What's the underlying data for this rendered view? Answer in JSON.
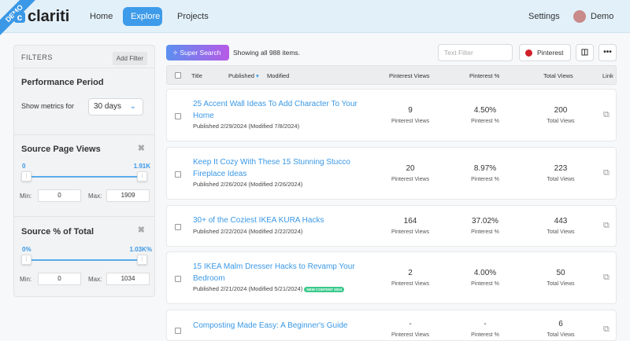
{
  "header": {
    "demo": "DEMO",
    "logo": "clariti",
    "nav": [
      "Home",
      "Explore",
      "Projects"
    ],
    "settings": "Settings",
    "user": "Demo"
  },
  "filters": {
    "title": "FILTERS",
    "add": "Add Filter",
    "period": {
      "title": "Performance Period",
      "label": "Show metrics for",
      "value": "30 days"
    },
    "spv": {
      "title": "Source Page Views",
      "lo": "0",
      "hi": "1.91K",
      "min_label": "Min:",
      "max_label": "Max:",
      "min": "0",
      "max": "1909"
    },
    "spt": {
      "title": "Source % of Total",
      "lo": "0%",
      "hi": "1.03K%",
      "min_label": "Min:",
      "max_label": "Max:",
      "min": "0",
      "max": "1034"
    }
  },
  "toolbar": {
    "super_search": "Super Search",
    "showing": "Showing all 988 items.",
    "text_filter": "Text Filter",
    "source": "Pinterest"
  },
  "columns": {
    "title": "Title",
    "published": "Published",
    "modified": "Modified",
    "pv": "Pinterest Views",
    "pp": "Pinterest %",
    "tv": "Total Views",
    "link": "Link"
  },
  "rows": [
    {
      "title": "25 Accent Wall Ideas To Add Character To Your Home",
      "meta": "Published 2/29/2024 (Modified 7/8/2024)",
      "badge": null,
      "pv": "9",
      "pp": "4.50%",
      "tv": "200"
    },
    {
      "title": "Keep It Cozy With These 15 Stunning Stucco Fireplace Ideas",
      "meta": "Published 2/26/2024 (Modified 2/26/2024)",
      "badge": null,
      "pv": "20",
      "pp": "8.97%",
      "tv": "223"
    },
    {
      "title": "30+ of the Coziest IKEA KURA Hacks",
      "meta": "Published 2/22/2024 (Modified 2/22/2024)",
      "badge": null,
      "pv": "164",
      "pp": "37.02%",
      "tv": "443"
    },
    {
      "title": "15 IKEA Malm Dresser Hacks to Revamp Your Bedroom",
      "meta": "Published 2/21/2024 (Modified 5/21/2024)",
      "badge": "NEW CONTENT 2024",
      "pv": "2",
      "pp": "4.00%",
      "tv": "50"
    },
    {
      "title": "Composting Made Easy: A Beginner's Guide",
      "meta": "",
      "badge": null,
      "pv": "-",
      "pp": "-",
      "tv": "6"
    }
  ],
  "stat_labels": {
    "pv": "Pinterest Views",
    "pp": "Pinterest %",
    "tv": "Total Views"
  }
}
